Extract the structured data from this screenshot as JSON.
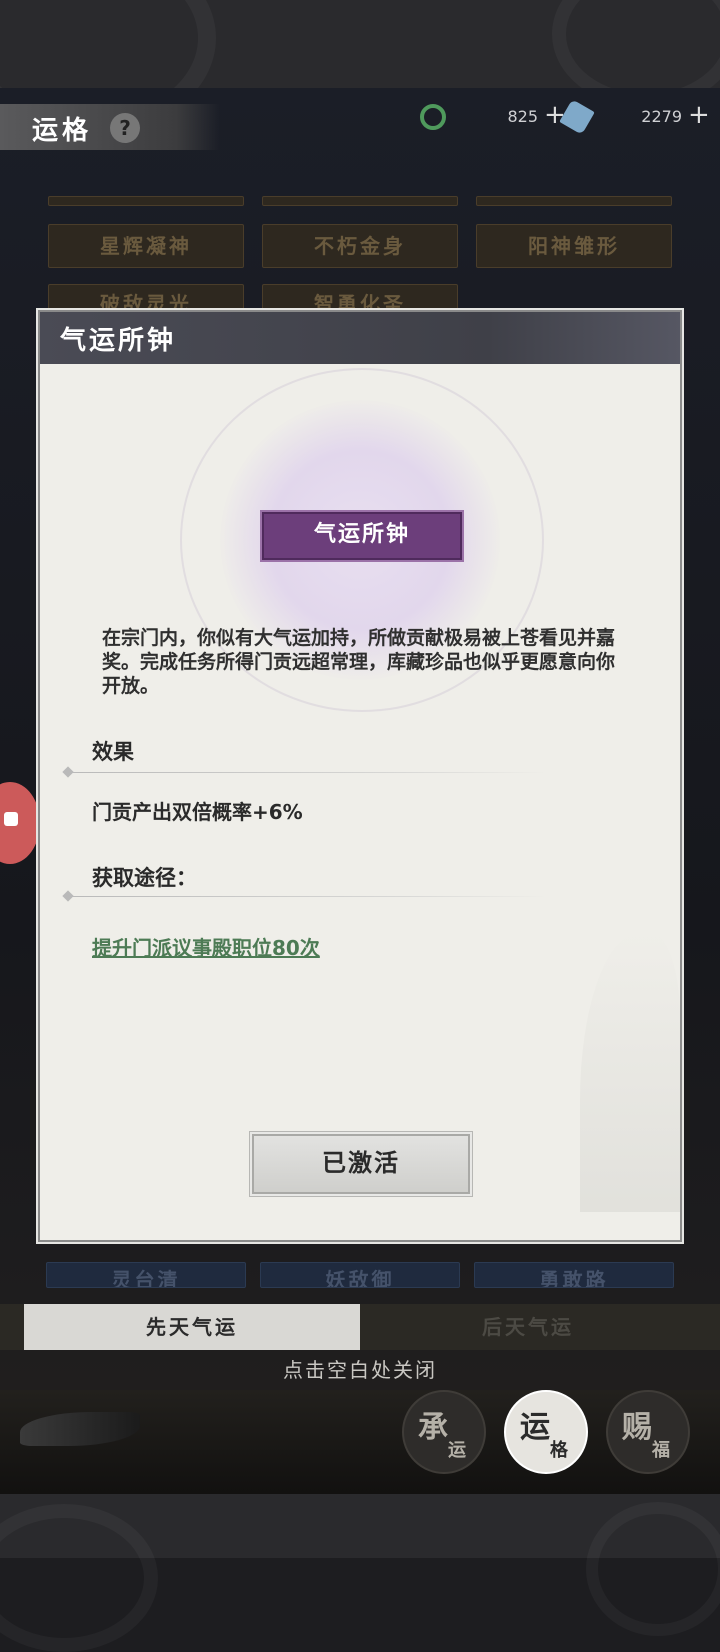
{
  "header": {
    "title": "运格",
    "help_icon": "question-mark-icon",
    "resources": [
      {
        "icon": "jade-coin-icon",
        "value": "825",
        "plus": "+"
      },
      {
        "icon": "spirit-stone-icon",
        "value": "2279",
        "plus": "+"
      }
    ]
  },
  "grid_tiles": {
    "row1": [
      "星辉凝神",
      "不朽金身",
      "阳神雏形"
    ],
    "row2": [
      "破敌灵光",
      "智勇化圣"
    ],
    "row_bottom": [
      "灵台清",
      "妖敌御",
      "勇敢路"
    ]
  },
  "modal": {
    "title": "气运所钟",
    "nameplate": "气运所钟",
    "description": "在宗门内，你似有大气运加持，所做贡献极易被上苍看见并嘉奖。完成任务所得门贡远超常理，库藏珍品也似乎更愿意向你开放。",
    "effect_heading": "效果",
    "effect_text": "门贡产出双倍概率+6%",
    "source_heading": "获取途径：",
    "source_link": "提升门派议事殿职位80次",
    "button_label": "已激活"
  },
  "tabs": [
    {
      "label": "先天气运",
      "active": true
    },
    {
      "label": "后天气运",
      "active": false
    }
  ],
  "hint": "点击空白处关闭",
  "bottom_nav": [
    {
      "big": "承",
      "small": "运",
      "active": false
    },
    {
      "big": "运",
      "small": "格",
      "active": true
    },
    {
      "big": "赐",
      "small": "福",
      "active": false
    }
  ]
}
